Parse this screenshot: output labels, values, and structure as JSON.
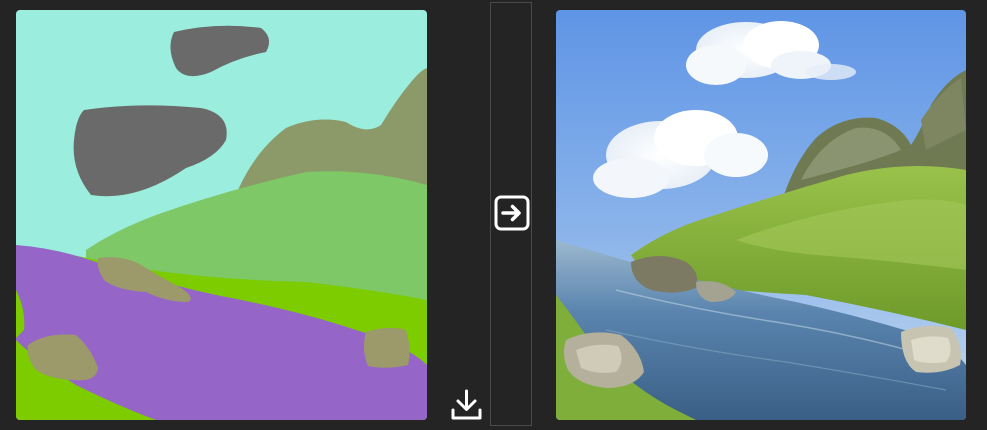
{
  "window": {
    "background": "#242424"
  },
  "segmentation_canvas": {
    "legend_colors": {
      "sky": "#9beedd",
      "cloud": "#6a6a6a",
      "mountain": "#8c9a6a",
      "grass": "#7ec867",
      "bright_grass": "#7ccc00",
      "water": "#9565c8",
      "rock": "#9c9a6b"
    }
  },
  "toolbar": {
    "download_icon": "download-icon",
    "generate_icon": "arrow-right-box-icon"
  },
  "output_image": {
    "sky_color": "#5f95e6",
    "water_color": "#5a84ae",
    "grass_color": "#7fae3b"
  }
}
